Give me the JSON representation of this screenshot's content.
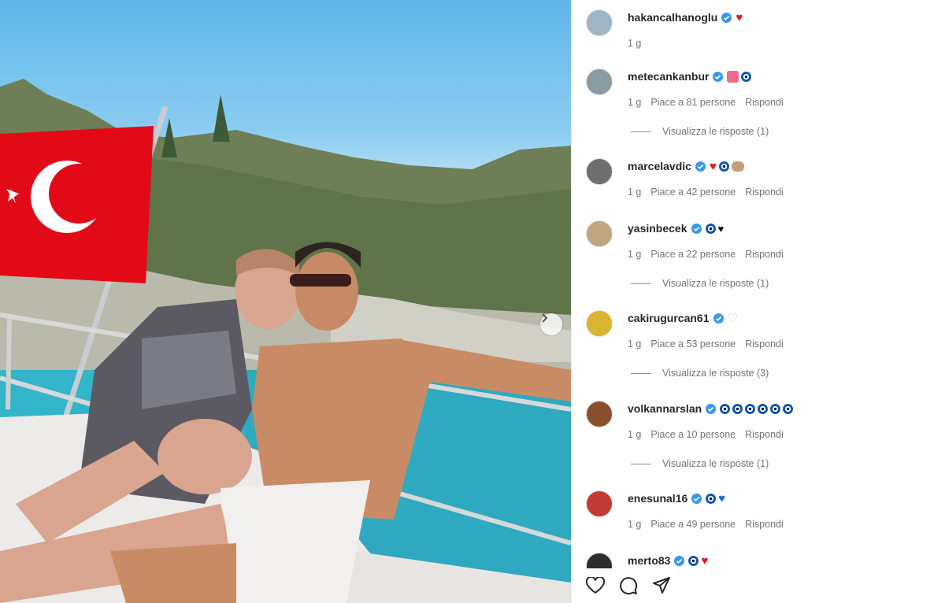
{
  "post": {
    "author": "hakancalhanoglu",
    "caption_emoji": "red-heart",
    "age": "1 g"
  },
  "comments": [
    {
      "username": "metecankanbur",
      "emojis": [
        "heart-ribbon",
        "evil-eye"
      ],
      "age": "1 g",
      "likes": "Piace a 81 persone",
      "reply": "Rispondi",
      "replies": "Visualizza le risposte (1)"
    },
    {
      "username": "marcelavdic",
      "emojis": [
        "red-heart",
        "evil-eye",
        "raised-hands"
      ],
      "age": "1 g",
      "likes": "Piace a 42 persone",
      "reply": "Rispondi",
      "replies": ""
    },
    {
      "username": "yasinbecek",
      "emojis": [
        "evil-eye",
        "black-heart"
      ],
      "age": "1 g",
      "likes": "Piace a 22 persone",
      "reply": "Rispondi",
      "replies": "Visualizza le risposte (1)"
    },
    {
      "username": "cakirugurcan61",
      "emojis": [
        "white-heart"
      ],
      "age": "1 g",
      "likes": "Piace a 53 persone",
      "reply": "Rispondi",
      "replies": "Visualizza le risposte (3)"
    },
    {
      "username": "volkannarslan",
      "emojis": [
        "evil-eye",
        "evil-eye",
        "evil-eye",
        "evil-eye",
        "evil-eye",
        "evil-eye"
      ],
      "age": "1 g",
      "likes": "Piace a 10 persone",
      "reply": "Rispondi",
      "replies": "Visualizza le risposte (1)"
    },
    {
      "username": "enesunal16",
      "emojis": [
        "evil-eye",
        "blue-heart"
      ],
      "age": "1 g",
      "likes": "Piace a 49 persone",
      "reply": "Rispondi",
      "replies": ""
    },
    {
      "username": "merto83",
      "emojis": [
        "evil-eye",
        "red-heart"
      ],
      "age": "",
      "likes": "",
      "reply": "",
      "replies": ""
    }
  ],
  "actions": {
    "like_icon": "heart-outline-icon",
    "comment_icon": "comment-icon",
    "share_icon": "share-icon"
  },
  "colors": {
    "verified": "#3897f0",
    "flag_red": "#e30a17",
    "sea": "#2fb3c4",
    "sky": "#6ab8ea"
  }
}
